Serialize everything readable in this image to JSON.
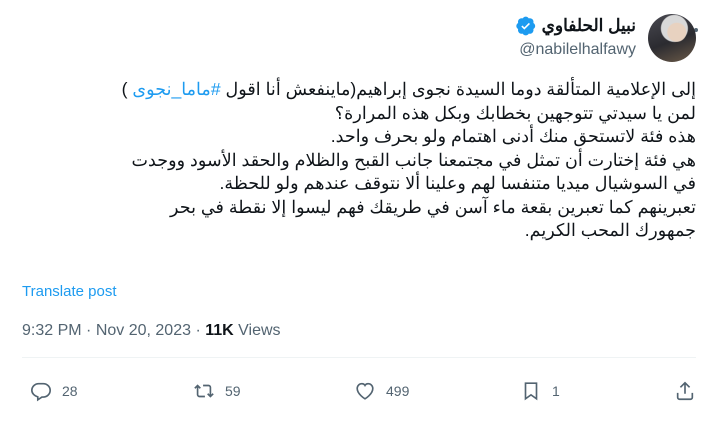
{
  "author": {
    "name": "نبيل الحلفاوي",
    "handle": "@nabilelhalfawy"
  },
  "tweet": {
    "line1_prefix": "إلى الإعلامية المتألقة دوما السيدة نجوى إبراهيم(ماينفعش أنا اقول ",
    "hashtag": "#ماما_نجوى",
    "line1_suffix": " )",
    "line2": "لمن يا سيدتي تتوجهين بخطابك وبكل هذه المرارة؟",
    "line3": "هذه فئة لاتستحق منك أدنى اهتمام ولو بحرف واحد.",
    "line4": "هي فئة إختارت أن تمثل في مجتمعنا جانب القبح والظلام والحقد الأسود ووجدت",
    "line5": "في السوشيال ميديا متنفسا لهم وعلينا ألا نتوقف عندهم ولو للحظة.",
    "line6": "تعبرينهم كما تعبرين بقعة ماء آسن في طريقك فهم ليسوا إلا نقطة في بحر",
    "line7": "جمهورك المحب الكريم."
  },
  "translate_label": "Translate post",
  "meta": {
    "time": "9:32 PM",
    "sep1": " · ",
    "date": "Nov 20, 2023",
    "sep2": " · ",
    "views_count": "11K",
    "views_label": " Views"
  },
  "actions": {
    "replies": "28",
    "reposts": "59",
    "likes": "499",
    "bookmarks": "1"
  },
  "colors": {
    "accent": "#1d9bf0",
    "muted": "#536471",
    "text": "#0f1419"
  },
  "icons": [
    "more-icon",
    "verified-icon",
    "reply-icon",
    "repost-icon",
    "like-icon",
    "bookmark-icon",
    "share-icon"
  ]
}
